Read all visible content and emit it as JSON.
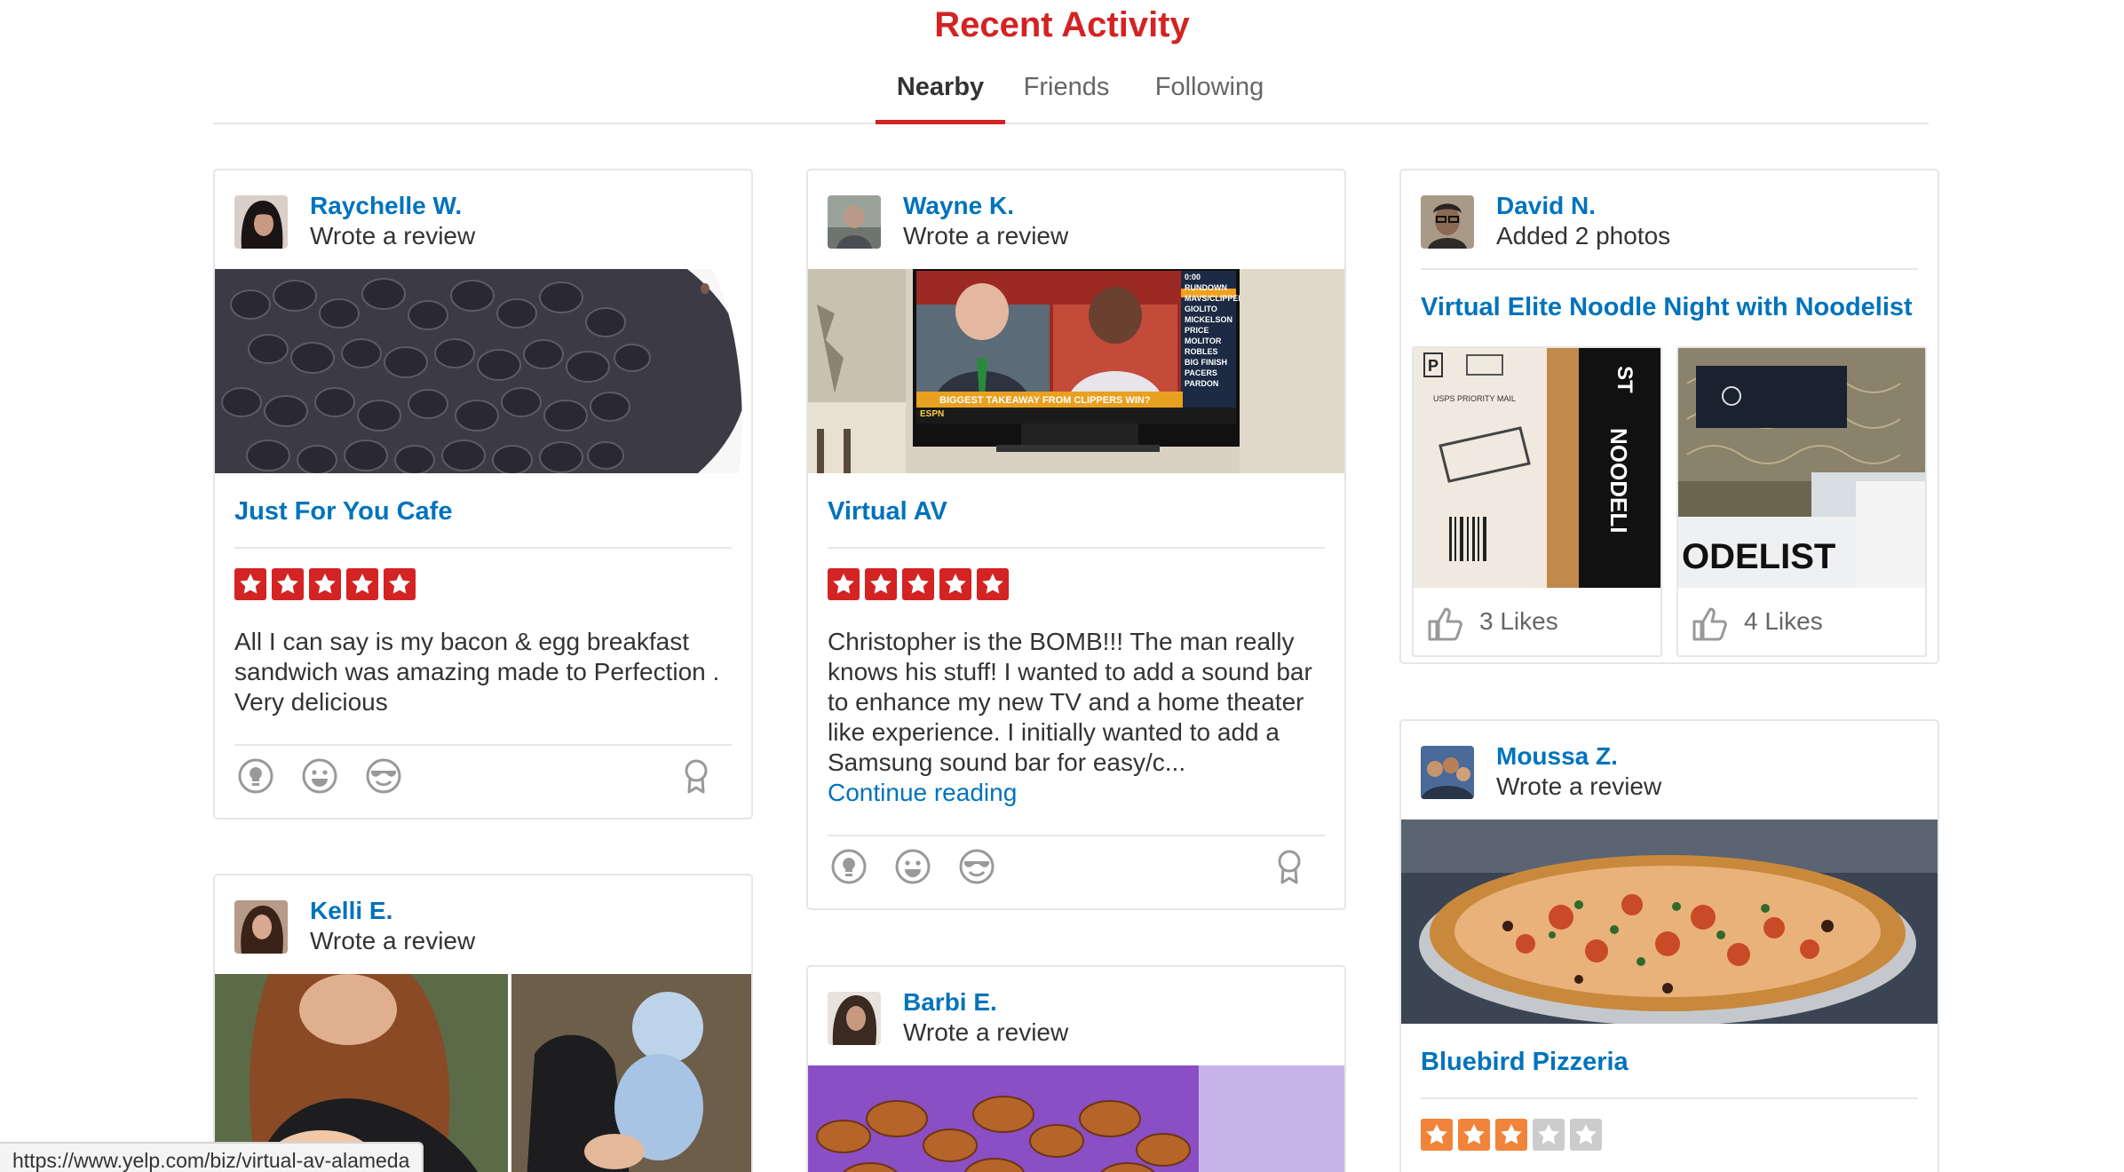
{
  "page": {
    "title": "Recent Activity"
  },
  "tabs": [
    {
      "label": "Nearby",
      "active": true
    },
    {
      "label": "Friends",
      "active": false
    },
    {
      "label": "Following",
      "active": false
    }
  ],
  "colors": {
    "brand_red": "#d32323",
    "link_blue": "#0073bb",
    "orange_star": "#f1843a",
    "gray_star": "#cccccc"
  },
  "cards": {
    "raychelle": {
      "user": "Raychelle W.",
      "action": "Wrote a review",
      "business": "Just For You Cafe",
      "rating": 5,
      "text": "All I can say is my bacon & egg breakfast sandwich was amazing made to Perfection . Very delicious",
      "actions": [
        "useful-icon",
        "funny-icon",
        "cool-icon",
        "award-icon"
      ]
    },
    "wayne": {
      "user": "Wayne K.",
      "action": "Wrote a review",
      "business": "Virtual AV",
      "rating": 5,
      "text": "Christopher is the BOMB!!! The man really knows his stuff! I wanted to add a sound bar to enhance my new TV and a home theater like experience. I initially wanted to add a Samsung sound bar for easy/c...",
      "continue": "Continue reading",
      "tv_caption": "BIGGEST TAKEAWAY FROM CLIPPERS WIN?",
      "tv_sidebar": [
        "0:00",
        "RUNDOWN",
        "MAVS/CLIPPERS",
        "GIOLITO",
        "MICKELSON",
        "PRICE",
        "MOLITOR",
        "ROBLES",
        "BIG FINISH",
        "PACERS",
        "PARDON"
      ],
      "tv_logo": "ESPN",
      "actions": [
        "useful-icon",
        "funny-icon",
        "cool-icon",
        "award-icon"
      ]
    },
    "david": {
      "user": "David N.",
      "action": "Added 2 photos",
      "business": "Virtual Elite Noodle Night with Noodelist",
      "photos": [
        {
          "likes": "3 Likes",
          "box_label": "P",
          "mail_label": "USPS PRIORITY MAIL",
          "brand": "NOODELI",
          "brand_small": "ST"
        },
        {
          "likes": "4 Likes",
          "brand": "ODELIST"
        }
      ]
    },
    "moussa": {
      "user": "Moussa Z.",
      "action": "Wrote a review",
      "business": "Bluebird Pizzeria",
      "rating": 3
    },
    "kelli": {
      "user": "Kelli E.",
      "action": "Wrote a review"
    },
    "barbi": {
      "user": "Barbi E.",
      "action": "Wrote a review"
    }
  },
  "status_bar": {
    "url": "https://www.yelp.com/biz/virtual-av-alameda"
  }
}
